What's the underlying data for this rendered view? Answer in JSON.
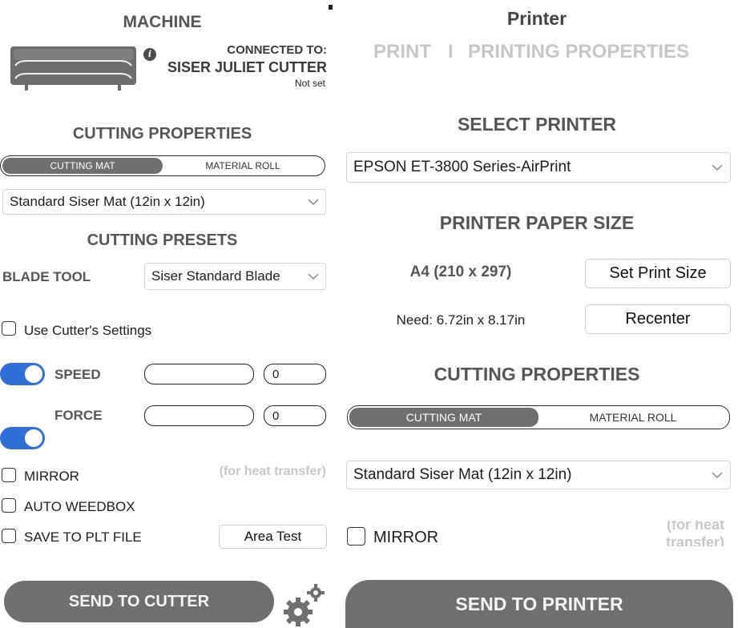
{
  "left": {
    "machine": {
      "title": "MACHINE",
      "connected_label": "CONNECTED TO:",
      "device_name": "SISER JULIET CUTTER",
      "status": "Not set",
      "info_icon": "info-icon"
    },
    "cutting_properties": {
      "title": "CUTTING PROPERTIES",
      "tabs": [
        "CUTTING MAT",
        "MATERIAL ROLL"
      ],
      "active_tab": 0,
      "mat_select": "Standard Siser Mat (12in x 12in)"
    },
    "presets": {
      "title": "CUTTING PRESETS",
      "blade_label": "BLADE TOOL",
      "blade_value": "Siser Standard Blade",
      "use_cutter_settings": "Use Cutter's Settings",
      "speed_label": "SPEED",
      "speed_value": "0",
      "force_label": "FORCE",
      "force_value": "0",
      "speed_toggle_on": true,
      "force_toggle_on": true
    },
    "options": {
      "mirror": "MIRROR",
      "mirror_hint": "(for heat transfer)",
      "auto_weedbox": "AUTO WEEDBOX",
      "save_plt": "SAVE TO PLT FILE",
      "area_test": "Area Test"
    },
    "send_button": "SEND TO CUTTER",
    "settings_icon": "gears-icon"
  },
  "right": {
    "title": "Printer",
    "tabs": [
      "PRINT",
      "I",
      "PRINTING PROPERTIES"
    ],
    "select_printer_title": "SELECT PRINTER",
    "printer_value": "EPSON ET-3800 Series-AirPrint",
    "paper_size_title": "PRINTER PAPER SIZE",
    "paper_size": "A4 (210 x 297)",
    "set_print_size": "Set Print Size",
    "need_text": "Need: 6.72in x 8.17in",
    "recenter": "Recenter",
    "cutting_properties_title": "CUTTING PROPERTIES",
    "cutting_tabs": [
      "CUTTING MAT",
      "MATERIAL ROLL"
    ],
    "active_tab": 0,
    "mat_select": "Standard Siser Mat (12in x 12in)",
    "mirror": "MIRROR",
    "mirror_hint_line1": "(for heat",
    "mirror_hint_line2": "transfer)",
    "send_button": "SEND TO PRINTER"
  },
  "colors": {
    "accent_toggle": "#2f6fd6",
    "button_grey": "#6f6f6f",
    "heading_grey": "#555555",
    "muted_text": "#c6c6c6"
  }
}
